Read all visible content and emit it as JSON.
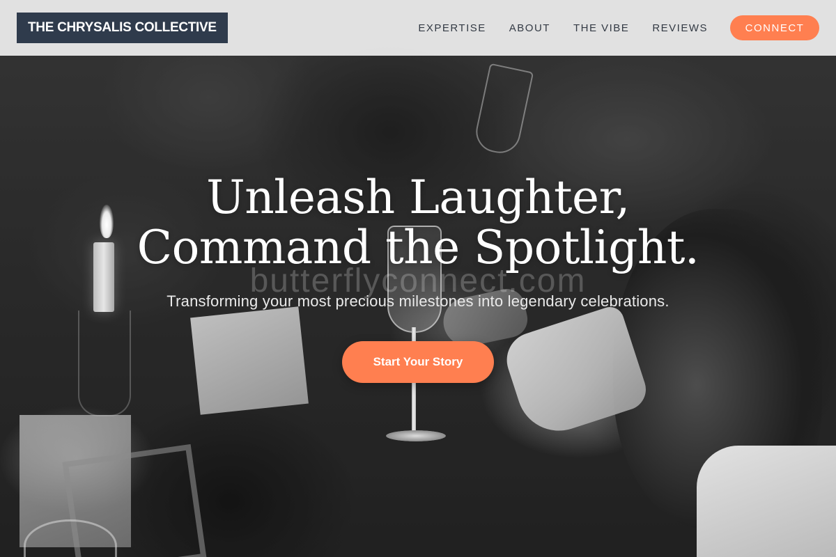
{
  "header": {
    "brand": "THE CHRYSALIS COLLECTIVE",
    "nav": [
      {
        "label": "EXPERTISE"
      },
      {
        "label": "ABOUT"
      },
      {
        "label": "THE VIBE"
      },
      {
        "label": "REVIEWS"
      }
    ],
    "cta_label": "CONNECT"
  },
  "hero": {
    "title_line1": "Unleash Laughter,",
    "title_line2": "Command the Spotlight.",
    "watermark": "butterflyconnect.com",
    "subtitle": "Transforming your most precious milestones into legendary celebrations.",
    "cta_label": "Start Your Story",
    "background_description_icon": "celebration-photo"
  },
  "colors": {
    "accent": "#ff7f50",
    "brand_bg": "#2f3b4c",
    "header_bg": "#e8e8e8",
    "nav_text": "#333a44"
  }
}
